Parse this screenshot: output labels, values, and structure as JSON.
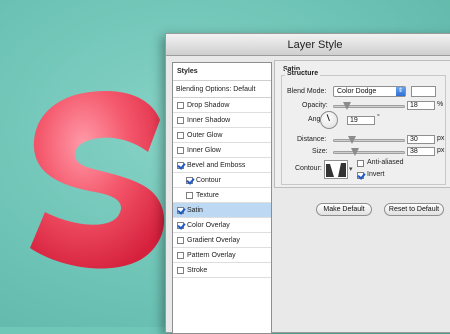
{
  "dialog": {
    "title": "Layer Style"
  },
  "styles_panel": {
    "header": "Styles",
    "blending_options": "Blending Options: Default",
    "items": [
      {
        "label": "Drop Shadow",
        "checked": false,
        "sub": false,
        "selected": false
      },
      {
        "label": "Inner Shadow",
        "checked": false,
        "sub": false,
        "selected": false
      },
      {
        "label": "Outer Glow",
        "checked": false,
        "sub": false,
        "selected": false
      },
      {
        "label": "Inner Glow",
        "checked": false,
        "sub": false,
        "selected": false
      },
      {
        "label": "Bevel and Emboss",
        "checked": true,
        "sub": false,
        "selected": false
      },
      {
        "label": "Contour",
        "checked": true,
        "sub": true,
        "selected": false
      },
      {
        "label": "Texture",
        "checked": false,
        "sub": true,
        "selected": false
      },
      {
        "label": "Satin",
        "checked": true,
        "sub": false,
        "selected": true
      },
      {
        "label": "Color Overlay",
        "checked": true,
        "sub": false,
        "selected": false
      },
      {
        "label": "Gradient Overlay",
        "checked": false,
        "sub": false,
        "selected": false
      },
      {
        "label": "Pattern Overlay",
        "checked": false,
        "sub": false,
        "selected": false
      },
      {
        "label": "Stroke",
        "checked": false,
        "sub": false,
        "selected": false
      }
    ]
  },
  "satin": {
    "title": "Satin",
    "structure_title": "Structure",
    "blend_mode_label": "Blend Mode:",
    "blend_mode_value": "Color Dodge",
    "blend_color": "#ffffff",
    "opacity_label": "Opacity:",
    "opacity_value": "18",
    "opacity_unit": "%",
    "angle_label": "Angle:",
    "angle_value": "19",
    "angle_unit": "°",
    "distance_label": "Distance:",
    "distance_value": "30",
    "distance_unit": "px",
    "size_label": "Size:",
    "size_value": "38",
    "size_unit": "px",
    "contour_label": "Contour:",
    "anti_aliased_label": "Anti-aliased",
    "anti_aliased_checked": false,
    "invert_label": "Invert",
    "invert_checked": true,
    "make_default_label": "Make Default",
    "reset_default_label": "Reset to Default"
  },
  "canvas": {
    "background_color": "#6fc7b8",
    "letter_color": "#f0495f"
  }
}
